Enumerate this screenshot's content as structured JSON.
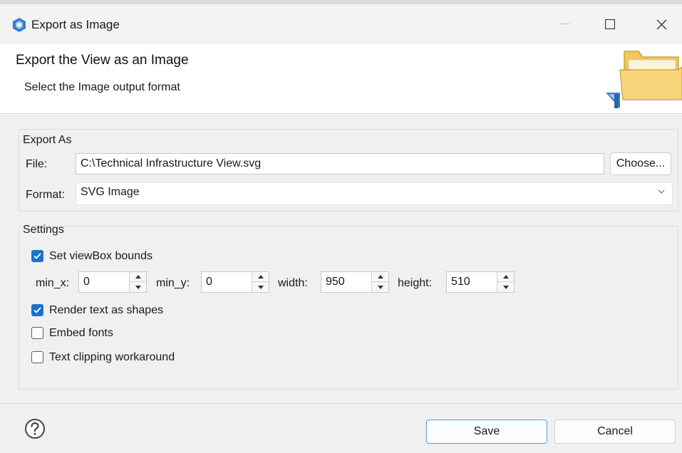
{
  "window": {
    "title": "Export as Image",
    "icon": "app-logo-icon",
    "controls": [
      "minimize-icon",
      "maximize-icon",
      "close-icon"
    ]
  },
  "banner": {
    "title": "Export the View as an Image",
    "subtitle": "Select the Image output format",
    "image": "folder-icon"
  },
  "export_as": {
    "label": "Export As",
    "file_label": "File:",
    "file_value": "C:\\Technical Infrastructure View.svg",
    "choose_label": "Choose...",
    "format_label": "Format:",
    "format_value": "SVG Image"
  },
  "settings": {
    "label": "Settings",
    "viewbox_label": "Set viewBox bounds",
    "viewbox_checked": true,
    "min_x_label": "min_x:",
    "min_x_value": "0",
    "min_y_label": "min_y:",
    "min_y_value": "0",
    "width_label": "width:",
    "width_value": "950",
    "height_label": "height:",
    "height_value": "510",
    "render_text_label": "Render text as shapes",
    "render_text_checked": true,
    "embed_fonts_label": "Embed fonts",
    "embed_fonts_checked": false,
    "text_clipping_label": "Text clipping workaround",
    "text_clipping_checked": false
  },
  "footer": {
    "help_icon": "help-icon",
    "save_label": "Save",
    "cancel_label": "Cancel"
  },
  "colors": {
    "accent": "#1a73c9",
    "save_border": "#5b9bd5",
    "background": "#f0f0f0"
  }
}
